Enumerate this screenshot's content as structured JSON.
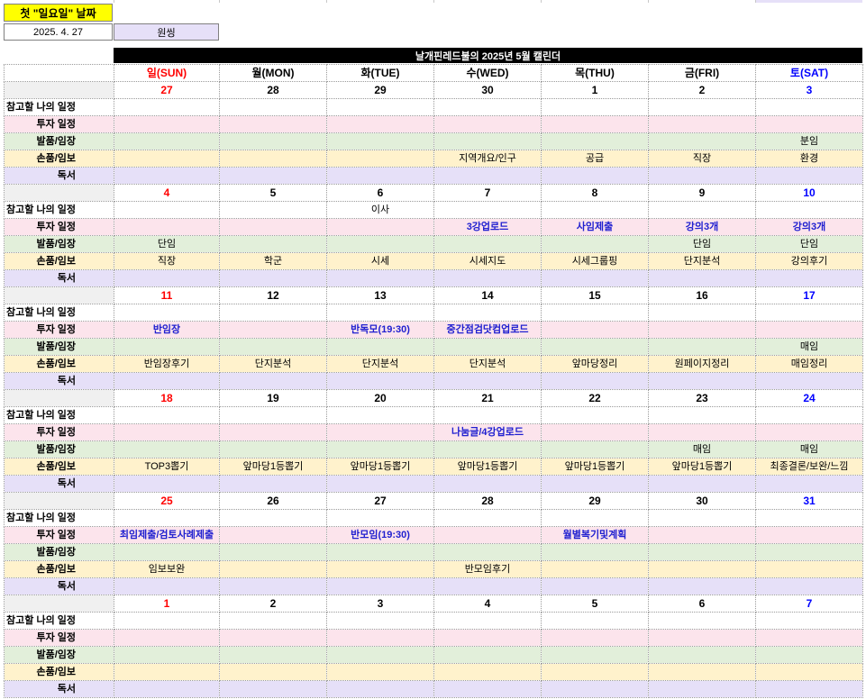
{
  "header": {
    "first_sunday_label": "첫 \"일요일\" 날짜",
    "first_sunday_date": "2025. 4. 27",
    "first_sunday_weekday": "원씽"
  },
  "calendar": {
    "title": "날개핀레드불의 2025년 5월 캘린더",
    "weekdays": [
      "일(SUN)",
      "월(MON)",
      "화(TUE)",
      "수(WED)",
      "목(THU)",
      "금(FRI)",
      "토(SAT)"
    ],
    "row_labels": [
      "참고할 나의 일정",
      "투자 일정",
      "발품/임장",
      "손품/임보",
      "독서"
    ],
    "weeks": [
      {
        "dates": [
          "27",
          "28",
          "29",
          "30",
          "1",
          "2",
          "3"
        ],
        "rows": [
          [
            "",
            "",
            "",
            "",
            "",
            "",
            ""
          ],
          [
            "",
            "",
            "",
            "",
            "",
            "",
            ""
          ],
          [
            "",
            "",
            "",
            "",
            "",
            "",
            "분임"
          ],
          [
            "",
            "",
            "",
            "지역개요/인구",
            "공급",
            "직장",
            "환경"
          ],
          [
            "",
            "",
            "",
            "",
            "",
            "",
            ""
          ]
        ]
      },
      {
        "dates": [
          "4",
          "5",
          "6",
          "7",
          "8",
          "9",
          "10"
        ],
        "rows": [
          [
            "",
            "",
            "이사",
            "",
            "",
            "",
            ""
          ],
          [
            "",
            "",
            "",
            "3강업로드",
            "사임제출",
            "강의3개",
            "강의3개"
          ],
          [
            "단임",
            "",
            "",
            "",
            "",
            "단임",
            "단임"
          ],
          [
            "직장",
            "학군",
            "시세",
            "시세지도",
            "시세그룹핑",
            "단지분석",
            "강의후기"
          ],
          [
            "",
            "",
            "",
            "",
            "",
            "",
            ""
          ]
        ]
      },
      {
        "dates": [
          "11",
          "12",
          "13",
          "14",
          "15",
          "16",
          "17"
        ],
        "rows": [
          [
            "",
            "",
            "",
            "",
            "",
            "",
            ""
          ],
          [
            "반임장",
            "",
            "반독모(19:30)",
            "중간점검닷컴업로드",
            "",
            "",
            ""
          ],
          [
            "",
            "",
            "",
            "",
            "",
            "",
            "매임"
          ],
          [
            "반임장후기",
            "단지분석",
            "단지분석",
            "단지분석",
            "앞마당정리",
            "원페이지정리",
            "매임정리"
          ],
          [
            "",
            "",
            "",
            "",
            "",
            "",
            ""
          ]
        ]
      },
      {
        "dates": [
          "18",
          "19",
          "20",
          "21",
          "22",
          "23",
          "24"
        ],
        "rows": [
          [
            "",
            "",
            "",
            "",
            "",
            "",
            ""
          ],
          [
            "",
            "",
            "",
            "나눔글/4강업로드",
            "",
            "",
            ""
          ],
          [
            "",
            "",
            "",
            "",
            "",
            "매임",
            "매임"
          ],
          [
            "TOP3뽑기",
            "앞마당1등뽑기",
            "앞마당1등뽑기",
            "앞마당1등뽑기",
            "앞마당1등뽑기",
            "앞마당1등뽑기",
            "최종결론/보완/느낌"
          ],
          [
            "",
            "",
            "",
            "",
            "",
            "",
            ""
          ]
        ]
      },
      {
        "dates": [
          "25",
          "26",
          "27",
          "28",
          "29",
          "30",
          "31"
        ],
        "rows": [
          [
            "",
            "",
            "",
            "",
            "",
            "",
            ""
          ],
          [
            "최임제출/검토사례제출",
            "",
            "반모임(19:30)",
            "",
            "월별복기및계획",
            "",
            ""
          ],
          [
            "",
            "",
            "",
            "",
            "",
            "",
            ""
          ],
          [
            "임보보완",
            "",
            "",
            "반모임후기",
            "",
            "",
            ""
          ],
          [
            "",
            "",
            "",
            "",
            "",
            "",
            ""
          ]
        ]
      },
      {
        "dates": [
          "1",
          "2",
          "3",
          "4",
          "5",
          "6",
          "7"
        ],
        "rows": [
          [
            "",
            "",
            "",
            "",
            "",
            "",
            ""
          ],
          [
            "",
            "",
            "",
            "",
            "",
            "",
            ""
          ],
          [
            "",
            "",
            "",
            "",
            "",
            "",
            ""
          ],
          [
            "",
            "",
            "",
            "",
            "",
            "",
            ""
          ],
          [
            "",
            "",
            "",
            "",
            "",
            "",
            ""
          ]
        ]
      }
    ]
  }
}
